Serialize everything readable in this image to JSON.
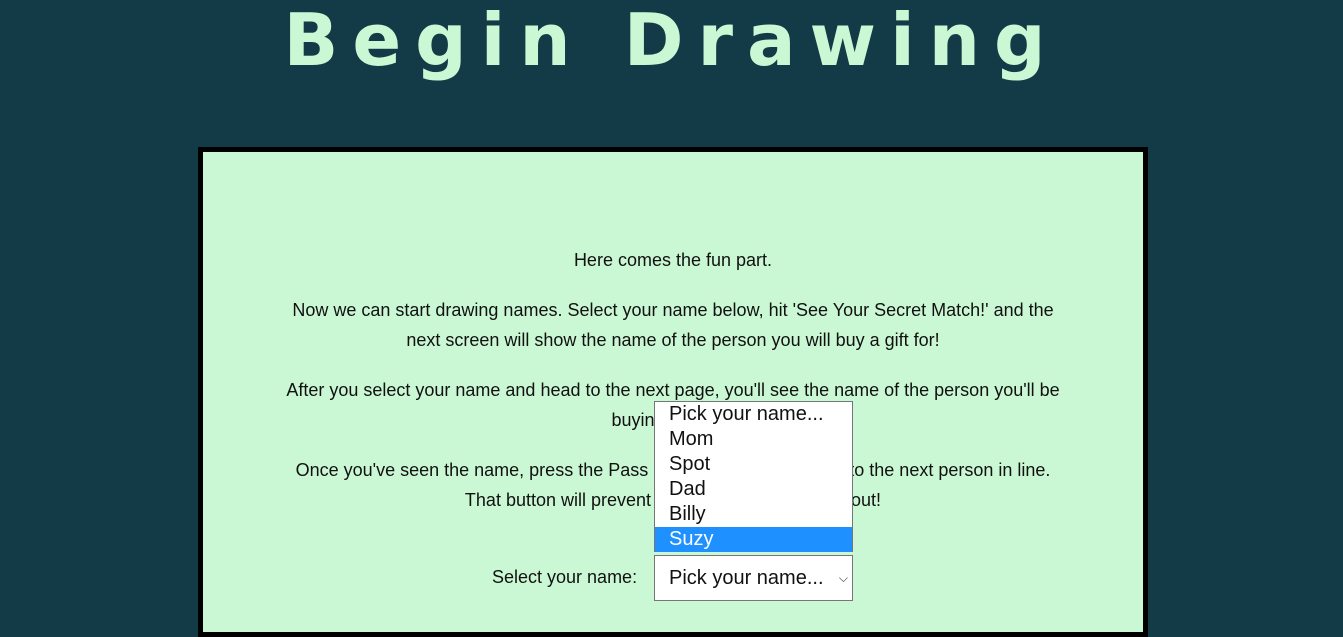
{
  "page": {
    "title": "Begin Drawing"
  },
  "card": {
    "paragraphs": [
      "Here comes the fun part.",
      "Now we can start drawing names. Select your name below, hit 'See Your Secret Match!' and the next screen will show the name of the person you will buy a gift for!",
      "After you select your name and head to the next page, you'll see the name of the person you'll be buying a gift for",
      "Once you've seen the name, press the Pass bu",
      "to the next person in line.",
      "That button will prevent",
      "out!"
    ],
    "select_label": "Select your name:",
    "select_value": "Pick your name..."
  },
  "dropdown": {
    "options": [
      "Pick your name...",
      "Mom",
      "Spot",
      "Dad",
      "Billy",
      "Suzy"
    ],
    "highlighted_index": 5
  },
  "colors": {
    "background": "#133b47",
    "card": "#cbf8d4",
    "title": "#cbf8d4",
    "highlight": "#1e90ff"
  }
}
